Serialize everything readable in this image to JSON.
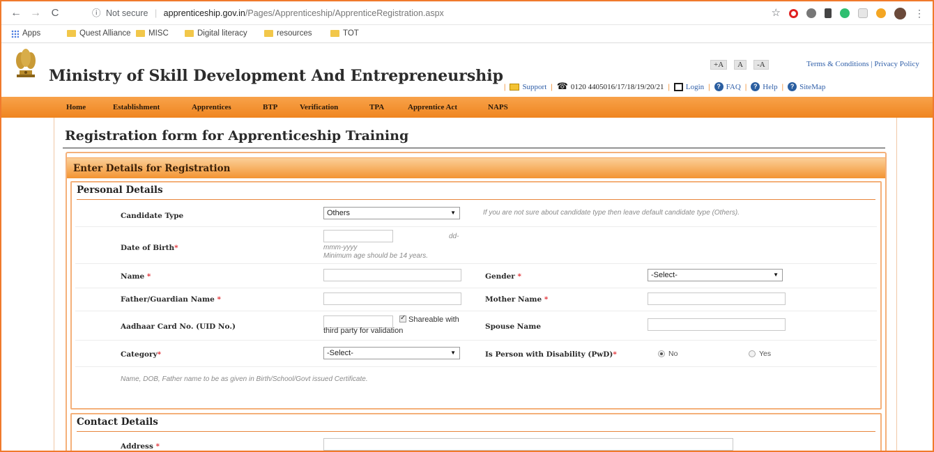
{
  "browser": {
    "security_label": "Not secure",
    "url_host": "apprenticeship.gov.in",
    "url_path": "/Pages/Apprenticeship/ApprenticeRegistration.aspx",
    "bookmarks": [
      "Apps",
      "Quest Alliance",
      "MISC",
      "Digital literacy",
      "resources",
      "TOT"
    ]
  },
  "header": {
    "title": "Ministry of Skill Development And Entrepreneurship",
    "font_controls": [
      "+A",
      "A",
      "-A"
    ],
    "terms_link": "Terms & Conditions",
    "privacy_link": "Privacy Policy",
    "support": "Support",
    "phone": "0120 4405016/17/18/19/20/21",
    "login": "Login",
    "faq": "FAQ",
    "help": "Help",
    "sitemap": "SiteMap"
  },
  "nav": [
    "Home",
    "Establishment",
    "Apprentices",
    "BTP",
    "Verification",
    "TPA",
    "Apprentice Act",
    "NAPS"
  ],
  "page": {
    "title": "Registration form for Apprenticeship Training",
    "section_title": "Enter Details for Registration"
  },
  "personal": {
    "heading": "Personal Details",
    "candidate_type_label": "Candidate Type",
    "candidate_type_value": "Others",
    "candidate_type_hint": "If you are not sure about candidate type then leave default candidate type (Others).",
    "dob_label": "Date of Birth",
    "dob_format_1": "dd-",
    "dob_format_2": "mmm-yyyy",
    "dob_hint": "Minimum age should be 14 years.",
    "name_label": "Name",
    "gender_label": "Gender",
    "gender_value": "-Select-",
    "father_label": "Father/Guardian Name",
    "mother_label": "Mother Name",
    "aadhaar_label": "Aadhaar Card No. (UID No.)",
    "shareable_1": "Shareable with",
    "shareable_2": "third party for validation",
    "spouse_label": "Spouse Name",
    "category_label": "Category",
    "category_value": "-Select-",
    "pwd_label": "Is Person with Disability (PwD)",
    "pwd_no": "No",
    "pwd_yes": "Yes",
    "note": "Name, DOB, Father name to be as given in Birth/School/Govt issued Certificate."
  },
  "contact": {
    "heading": "Contact Details",
    "address_label": "Address"
  },
  "colors": {
    "accent_orange": "#ef8520",
    "link_blue": "#2e5ea8",
    "required_red": "#e0282e"
  }
}
